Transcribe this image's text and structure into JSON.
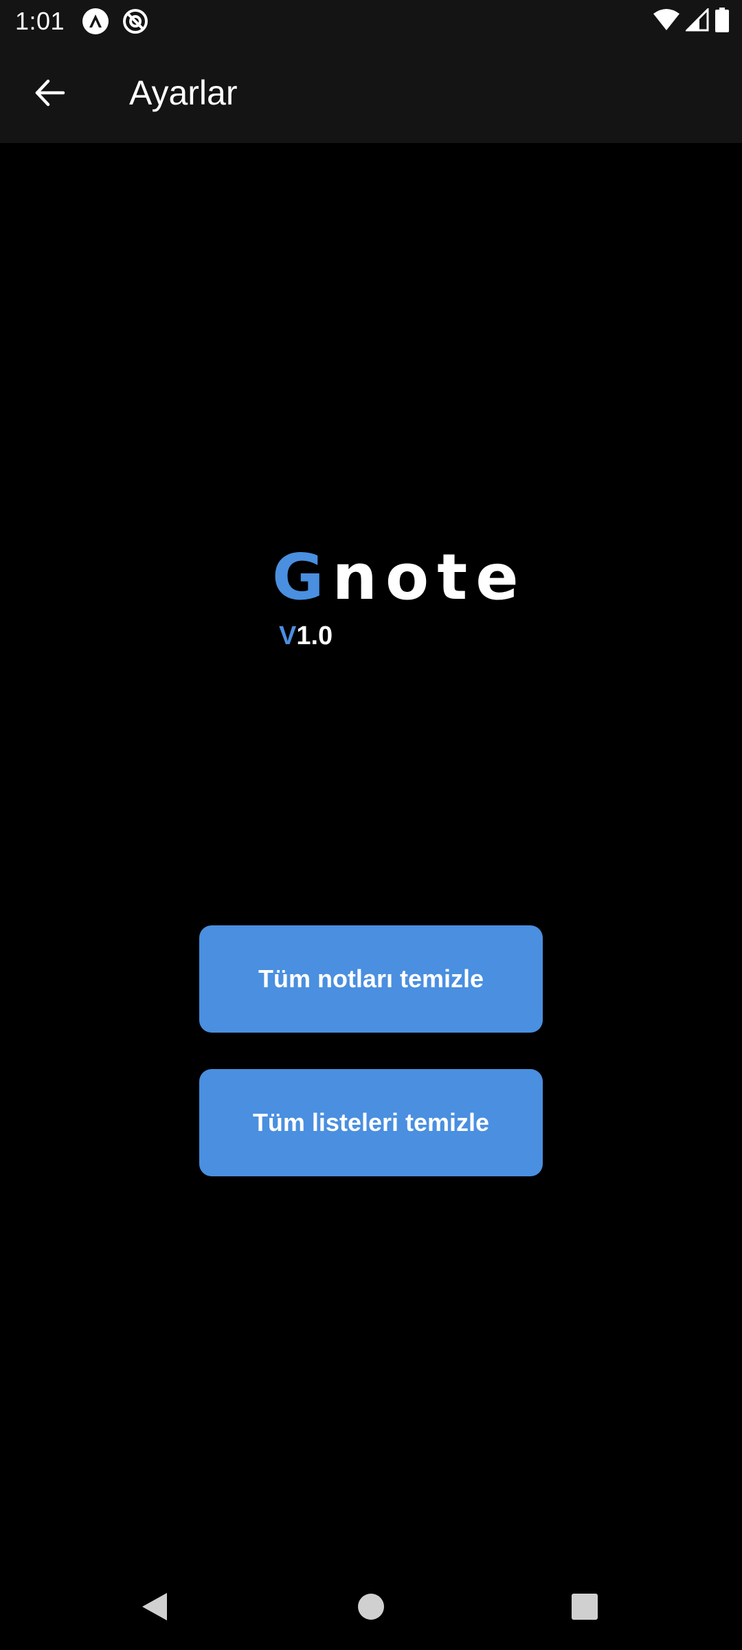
{
  "status_bar": {
    "time": "1:01",
    "icons": [
      "app-notification-icon",
      "do-not-disturb-icon",
      "wifi-icon",
      "cellular-signal-icon",
      "battery-icon"
    ]
  },
  "app_bar": {
    "title": "Ayarlar",
    "back_icon": "arrow-back-icon"
  },
  "logo": {
    "accent_letter": "G",
    "rest": "note",
    "version_prefix": "V",
    "version_number": "1.0"
  },
  "actions": {
    "clear_notes": "Tüm notları temizle",
    "clear_lists": "Tüm listeleri temizle"
  },
  "nav_bar": {
    "icons": [
      "nav-back-icon",
      "nav-home-icon",
      "nav-recents-icon"
    ]
  },
  "colors": {
    "accent": "#4a8fe0",
    "background": "#000000",
    "app_bar": "#141414",
    "text": "#ffffff"
  }
}
